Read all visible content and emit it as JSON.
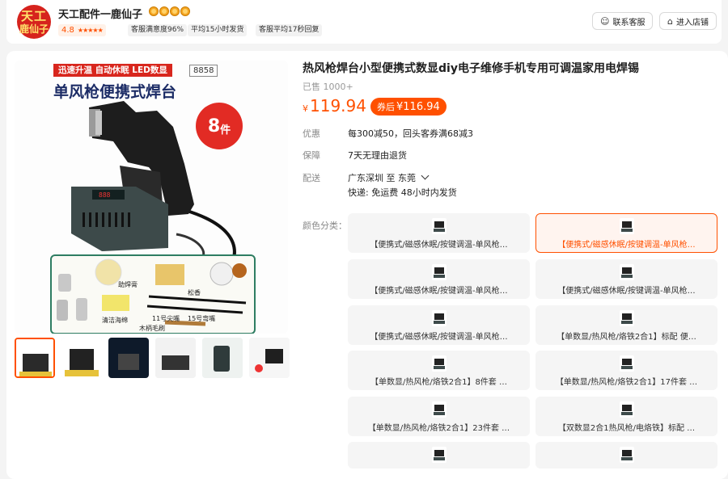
{
  "shop": {
    "logo_line1": "天工",
    "logo_line2": "鹿仙子",
    "name": "天工配件一鹿仙子",
    "crown_count": 4,
    "rating": "4.8",
    "stars": "★★★★★",
    "stats": [
      "客服满意度96%",
      "平均15小时发货",
      "客服平均17秒回复"
    ],
    "contact_label": "联系客服",
    "enter_label": "进入店铺"
  },
  "gallery": {
    "banner_red": "迅速升温 自动休眠 LED数显",
    "banner_id": "8858",
    "banner_title": "单风枪便携式焊台",
    "badge_number": "8",
    "badge_unit": "件",
    "accessory_labels": [
      "助焊膏",
      "松香",
      "清洁海绵",
      "11号尖嘴",
      "15号弯嘴",
      "木柄毛刷"
    ],
    "thumbnail_count": 6
  },
  "product": {
    "title": "热风枪焊台小型便携式数显diy电子维修手机专用可调温家用电焊锡",
    "sold": "已售 1000+",
    "currency": "¥",
    "price": "119.94",
    "coupon_prefix": "券后",
    "coupon_price": "¥116.94",
    "rows": [
      {
        "label": "优惠",
        "value": "每300减50，回头客券满68减3"
      },
      {
        "label": "保障",
        "value": "7天无理由退货"
      },
      {
        "label": "配送",
        "value": "广东深圳  至  东莞"
      }
    ],
    "shipping": "快递: 免运费  48小时内发货",
    "sku_label": "颜色分类："
  },
  "skus": [
    {
      "text": "【便携式/磁感休眠/按键调温-单风枪…",
      "selected": false
    },
    {
      "text": "【便携式/磁感休眠/按键调温-单风枪…",
      "selected": true
    },
    {
      "text": "【便携式/磁感休眠/按键调温-单风枪…",
      "selected": false
    },
    {
      "text": "【便携式/磁感休眠/按键调温-单风枪…",
      "selected": false
    },
    {
      "text": "【便携式/磁感休眠/按键调温-单风枪…",
      "selected": false
    },
    {
      "text": "【单数显/热风枪/烙铁2合1】标配 便…",
      "selected": false
    },
    {
      "text": "【单数显/热风枪/烙铁2合1】8件套 …",
      "selected": false
    },
    {
      "text": "【单数显/热风枪/烙铁2合1】17件套 …",
      "selected": false
    },
    {
      "text": "【单数显/热风枪/烙铁2合1】23件套 …",
      "selected": false
    },
    {
      "text": "【双数显2合1热风枪/电烙铁】标配 …",
      "selected": false
    },
    {
      "text": "",
      "selected": false
    },
    {
      "text": "",
      "selected": false
    }
  ],
  "colors": {
    "accent": "#ff5000",
    "logo_red": "#d6231d",
    "navy": "#1c2c66"
  }
}
